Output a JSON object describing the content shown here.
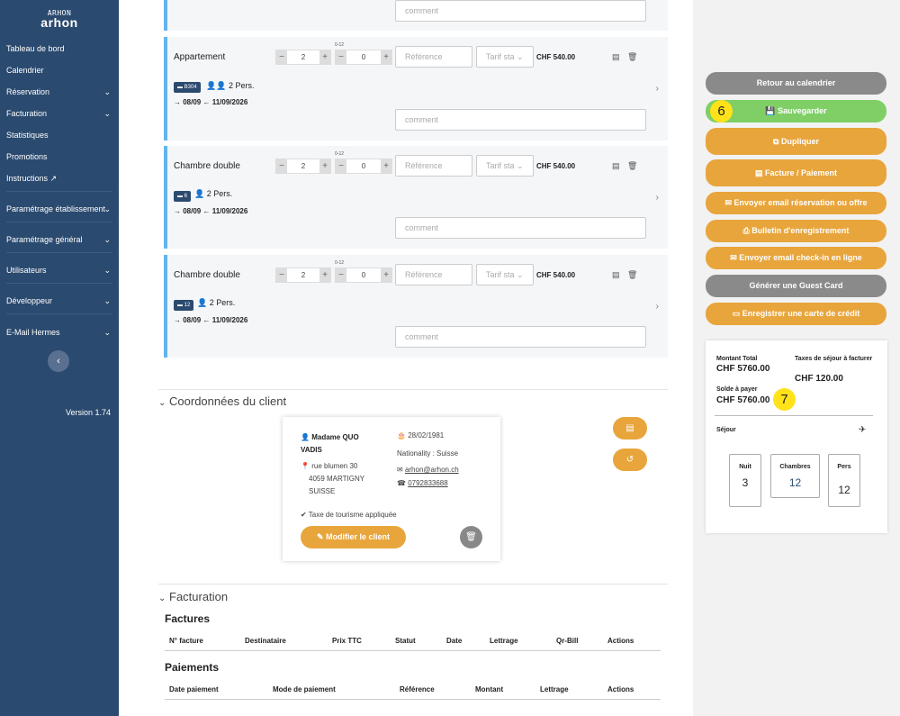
{
  "sidebar": {
    "logo_top": "ARHON",
    "logo_text": "arhon",
    "items": [
      {
        "label": "Tableau de bord",
        "chevron": false
      },
      {
        "label": "Calendrier",
        "chevron": false
      },
      {
        "label": "Réservation",
        "chevron": true
      },
      {
        "label": "Facturation",
        "chevron": true
      },
      {
        "label": "Statistiques",
        "chevron": false
      },
      {
        "label": "Promotions",
        "chevron": false
      },
      {
        "label": "Instructions",
        "chevron": false
      },
      {
        "label": "Paramétrage établissement",
        "chevron": true
      },
      {
        "label": "Paramétrage général",
        "chevron": true
      },
      {
        "label": "Utilisateurs",
        "chevron": true
      },
      {
        "label": "Développeur",
        "chevron": true
      },
      {
        "label": "E-Mail Hermes",
        "chevron": true
      }
    ],
    "collapse_icon": "‹",
    "version": "Version 1.74"
  },
  "rooms": [
    {
      "name": "Appartement",
      "adults": "2",
      "children": "0",
      "children_hint": "0-12",
      "reference_placeholder": "Référence",
      "tarif": "Tarif sta",
      "price": "CHF 540.00",
      "badge": "B304",
      "persons": "2 Pers.",
      "arrival": "08/09",
      "departure": "11/09/2026",
      "comment_placeholder": "comment"
    },
    {
      "name": "Chambre double",
      "adults": "2",
      "children": "0",
      "children_hint": "0-12",
      "reference_placeholder": "Référence",
      "tarif": "Tarif sta",
      "price": "CHF 540.00",
      "badge": "6",
      "persons": "2 Pers.",
      "arrival": "08/09",
      "departure": "11/09/2026",
      "comment_placeholder": "comment"
    },
    {
      "name": "Chambre double",
      "adults": "2",
      "children": "0",
      "children_hint": "0-12",
      "reference_placeholder": "Référence",
      "tarif": "Tarif sta",
      "price": "CHF 540.00",
      "badge": "12",
      "persons": "2 Pers.",
      "arrival": "08/09",
      "departure": "11/09/2026",
      "comment_placeholder": "comment"
    }
  ],
  "top_comment_placeholder": "comment",
  "client_section": {
    "title": "Coordonnées du client",
    "name": "Madame  QUO VADIS",
    "address1": "rue blumen 30",
    "address2": "4059 MARTIGNY",
    "country": "SUISSE",
    "birthdate": "28/02/1981",
    "nationality": "Nationality : Suisse",
    "email": "arhon@arhon.ch",
    "phone": "0792833688",
    "tax_note": "Taxe de tourisme appliquée",
    "edit_button": "Modifier le client"
  },
  "billing_section": {
    "title": "Facturation",
    "invoices_title": "Factures",
    "invoice_columns": [
      "N° facture",
      "Destinataire",
      "Prix TTC",
      "Statut",
      "Date",
      "Lettrage",
      "Qr-Bill",
      "Actions"
    ],
    "payments_title": "Paiements",
    "payment_columns": [
      "Date paiement",
      "Mode de paiement",
      "Référence",
      "Montant",
      "Lettrage",
      "Actions"
    ]
  },
  "actions": {
    "back": "Retour au calendrier",
    "save": "Sauvegarder",
    "duplicate": "Dupliquer",
    "invoice": "Facture / Paiement",
    "send_email": "Envoyer email réservation ou offre",
    "registration": "Bulletin d'enregistrement",
    "checkin_email": "Envoyer email check-in en ligne",
    "guest_card": "Générer une Guest Card",
    "credit_card": "Enregistrer une carte de crédit",
    "save_step": "6"
  },
  "summary": {
    "total_label": "Montant Total",
    "total_value": "CHF 5760.00",
    "tax_label": "Taxes de séjour à facturer",
    "tax_value": "CHF 120.00",
    "balance_label": "Solde à payer",
    "balance_value": "CHF 5760.00",
    "balance_step": "7",
    "stay_label": "Séjour",
    "nights_label": "Nuit",
    "nights": "3",
    "rooms_label": "Chambres",
    "rooms": "12",
    "pers_label": "Pers",
    "pers": "12"
  }
}
